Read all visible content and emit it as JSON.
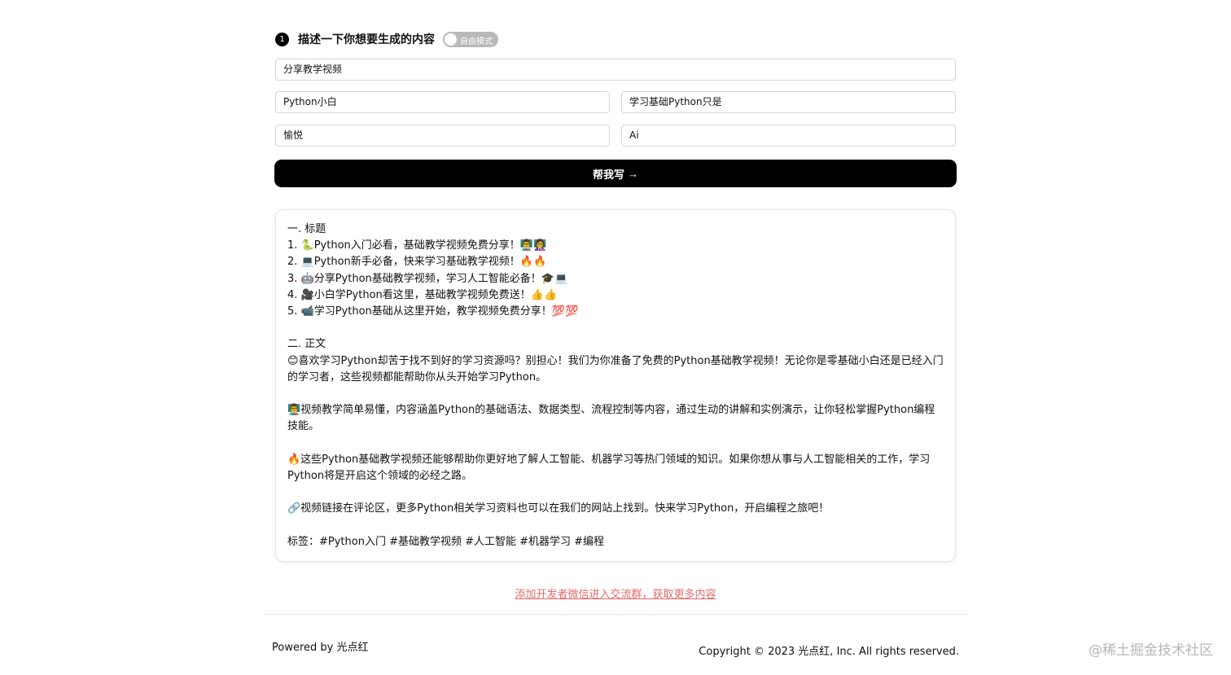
{
  "step": {
    "number": "1",
    "title": "描述一下你想要生成的内容",
    "toggle_label": "自由模式"
  },
  "inputs": {
    "topic": "分享教学视频",
    "audience": "Python小白",
    "content": "学习基础Python只是",
    "tone": "愉悦",
    "keyword": "Ai"
  },
  "generate_button": {
    "label": "帮我写",
    "arrow": "→"
  },
  "result": {
    "section1_heading": "一. 标题",
    "titles": [
      "1. 🐍Python入门必看，基础教学视频免费分享！👨‍🏫👩‍🏫",
      "2. 💻Python新手必备，快来学习基础教学视频！🔥🔥",
      "3. 🤖分享Python基础教学视频，学习人工智能必备！🎓💻",
      "4. 🎥小白学Python看这里，基础教学视频免费送！👍👍",
      "5. 📹学习Python基础从这里开始，教学视频免费分享！💯💯"
    ],
    "section2_heading": "二. 正文",
    "paragraphs": [
      "😊喜欢学习Python却苦于找不到好的学习资源吗？别担心！我们为你准备了免费的Python基础教学视频！无论你是零基础小白还是已经入门的学习者，这些视频都能帮助你从头开始学习Python。",
      "👨‍🏫视频教学简单易懂，内容涵盖Python的基础语法、数据类型、流程控制等内容，通过生动的讲解和实例演示，让你轻松掌握Python编程技能。",
      "🔥这些Python基础教学视频还能够帮助你更好地了解人工智能、机器学习等热门领域的知识。如果你想从事与人工智能相关的工作，学习Python将是开启这个领域的必经之路。",
      "🔗视频链接在评论区，更多Python相关学习资料也可以在我们的网站上找到。快来学习Python，开启编程之旅吧！"
    ],
    "tags": "标签：#Python入门 #基础教学视频 #人工智能 #机器学习 #编程"
  },
  "wechat_link": "添加开发者微信进入交流群，获取更多内容",
  "footer": {
    "powered_by": "Powered by 光点红",
    "copyright": "Copyright © 2023 光点红, Inc. All rights reserved."
  },
  "watermark": "@稀土掘金技术社区"
}
